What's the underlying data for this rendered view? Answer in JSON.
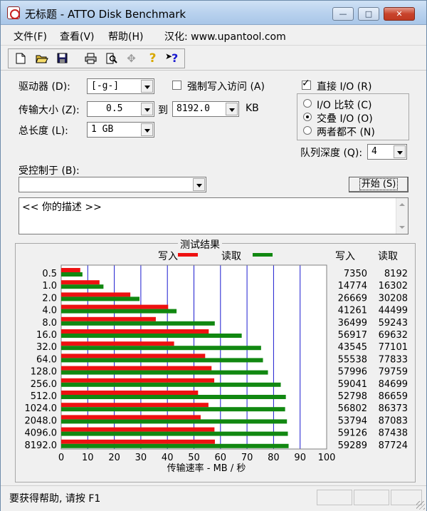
{
  "window": {
    "title": "无标题 - ATTO Disk Benchmark",
    "minimize_glyph": "—",
    "maximize_glyph": "□",
    "close_glyph": "✕"
  },
  "menu": {
    "file": "文件(F)",
    "view": "查看(V)",
    "help": "帮助(H)",
    "localized": "汉化: www.upantool.com"
  },
  "toolbar": {
    "icons": [
      "new-file-icon",
      "open-folder-icon",
      "save-icon",
      "print-icon",
      "print-preview-icon",
      "move-icon",
      "help-icon",
      "context-help-icon"
    ],
    "help_glyph": "?",
    "context_help_glyph": "?",
    "move_glyph": "✥"
  },
  "settings": {
    "drive_label": "驱动器 (D):",
    "drive_value": "[-g-]",
    "force_write_label": "强制写入访问 (A)",
    "force_write_checked": false,
    "transfer_size_label": "传输大小 (Z):",
    "transfer_from": "0.5",
    "to_label": "到",
    "transfer_to": "8192.0",
    "transfer_unit": "KB",
    "total_length_label": "总长度 (L):",
    "total_length_value": "1 GB",
    "direct_io_label": "直接 I/O (R)",
    "direct_io_checked": true,
    "check_glyph": "✓",
    "radio_compare": "I/O 比较 (C)",
    "radio_overlap": "交叠 I/O (O)",
    "radio_neither": "两者都不 (N)",
    "selected_radio": "overlap",
    "queue_depth_label": "队列深度 (Q):",
    "queue_depth_value": "4",
    "controlled_by_label": "受控制于 (B):",
    "controlled_by_value": "",
    "start_button": "开始 (S)",
    "description": "<<   你的描述    >>"
  },
  "results": {
    "title": "测试结果",
    "legend_write": "写入",
    "legend_read": "读取",
    "col_write": "写入",
    "col_read": "读取",
    "colors": {
      "write": "#ee1111",
      "read": "#118811",
      "grid": "#1a1ad0",
      "axis": "#000000"
    }
  },
  "chart_data": {
    "type": "bar",
    "orientation": "horizontal",
    "categories": [
      "0.5",
      "1.0",
      "2.0",
      "4.0",
      "8.0",
      "16.0",
      "32.0",
      "64.0",
      "128.0",
      "256.0",
      "512.0",
      "1024.0",
      "2048.0",
      "4096.0",
      "8192.0"
    ],
    "series": [
      {
        "name": "写入",
        "values": [
          7350,
          14774,
          26669,
          41261,
          36499,
          56917,
          43545,
          55538,
          57996,
          59041,
          52798,
          56802,
          53794,
          59126,
          59289
        ]
      },
      {
        "name": "读取",
        "values": [
          8192,
          16302,
          30208,
          44499,
          59243,
          69632,
          77101,
          77833,
          79759,
          84699,
          86659,
          86373,
          87083,
          87438,
          87724
        ]
      }
    ],
    "xlabel": "传输速率 - MB / 秒",
    "xlim": [
      0,
      100
    ],
    "xticks": [
      "0",
      "10",
      "20",
      "30",
      "40",
      "50",
      "60",
      "70",
      "80",
      "90",
      "100"
    ],
    "value_scale_kb_per_mb": 1024,
    "grid": true,
    "legend": "top"
  },
  "status": {
    "text": "要获得帮助, 请按 F1"
  }
}
